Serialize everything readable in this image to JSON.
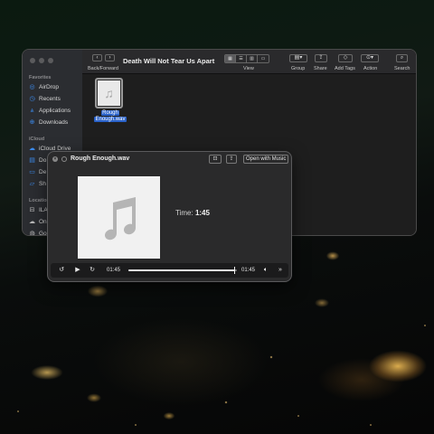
{
  "finder": {
    "title": "Death Will Not Tear Us Apart",
    "toolbar": {
      "back_forward_label": "Back/Forward",
      "view_label": "View",
      "group_label": "Group",
      "share_label": "Share",
      "add_tags_label": "Add Tags",
      "action_label": "Action",
      "search_label": "Search"
    },
    "sidebar": {
      "favorites_heading": "Favorites",
      "favorites": [
        {
          "label": "AirDrop",
          "icon": "airdrop-icon"
        },
        {
          "label": "Recents",
          "icon": "clock-icon"
        },
        {
          "label": "Applications",
          "icon": "applications-icon"
        },
        {
          "label": "Downloads",
          "icon": "download-icon"
        }
      ],
      "icloud_heading": "iCloud",
      "icloud": [
        {
          "label": "iCloud Drive",
          "icon": "cloud-icon"
        },
        {
          "label": "Do",
          "icon": "document-icon"
        },
        {
          "label": "De",
          "icon": "desktop-icon"
        },
        {
          "label": "Sh",
          "icon": "shared-folder-icon"
        }
      ],
      "locations_heading": "Location",
      "locations": [
        {
          "label": "ILA",
          "icon": "disk-icon"
        },
        {
          "label": "On",
          "icon": "cloud-icon"
        },
        {
          "label": "Go",
          "icon": "network-icon"
        }
      ]
    },
    "file": {
      "name_line1": "Rough",
      "name_line2": "Enough.wav"
    }
  },
  "quicklook": {
    "title": "Rough Enough.wav",
    "open_with_label": "Open with Music",
    "time_label": "Time:",
    "time_value": "1:45",
    "current_time": "01:45",
    "total_time": "01:45",
    "progress_fraction": 0.98
  },
  "colors": {
    "selection_blue": "#2a62c9",
    "accent_blue": "#3b8cf0"
  }
}
